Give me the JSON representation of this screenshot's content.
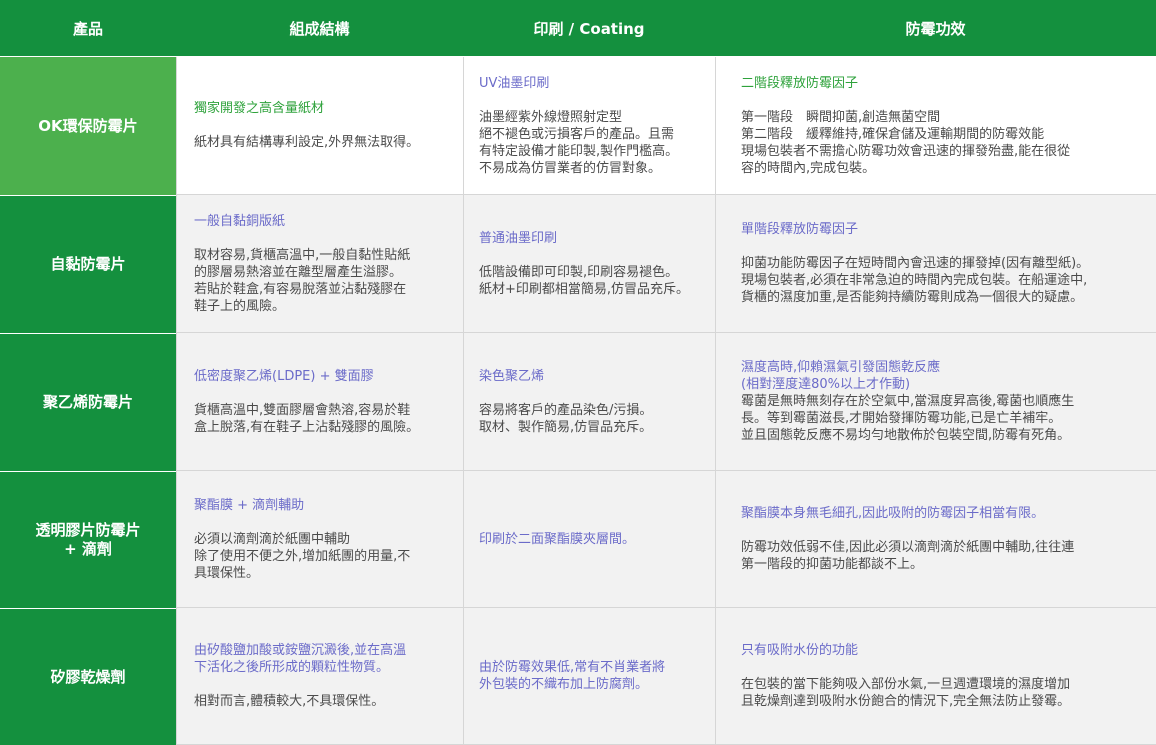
{
  "header": {
    "product": "產品",
    "structure": "組成結構",
    "printing": "印刷 / Coating",
    "effect": "防霉功效"
  },
  "rows": [
    {
      "name_lines": [
        "OK環保防霉片"
      ],
      "structure": {
        "title": "獨家開發之高含量紙材",
        "body": [
          "紙材具有結構專利設定,外界無法取得。"
        ]
      },
      "printing": {
        "title": "UV油墨印刷",
        "body": [
          "油墨經紫外線燈照射定型",
          "絕不褪色或污損客戶的產品。且需",
          "有特定設備才能印製,製作門檻高。",
          "不易成為仿冒業者的仿冒對象。"
        ]
      },
      "effect": {
        "title": "二階段釋放防霉因子",
        "body": [
          "第一階段　瞬間抑菌,創造無菌空間",
          "第二階段　緩釋維持,確保倉儲及運輸期間的防霉效能",
          "現場包裝者不需擔心防霉功效會迅速的揮發殆盡,能在很從",
          "容的時間內,完成包裝。"
        ]
      }
    },
    {
      "name_lines": [
        "自黏防霉片"
      ],
      "structure": {
        "title": "一般自黏銅版紙",
        "body": [
          "取材容易,貨櫃高溫中,一般自黏性貼紙",
          "的膠層易熱溶並在離型層產生溢膠。",
          "若貼於鞋盒,有容易脫落並沾黏殘膠在",
          "鞋子上的風險。"
        ]
      },
      "printing": {
        "title": "普通油墨印刷",
        "body": [
          "低階設備即可印製,印刷容易褪色。",
          "紙材+印刷都相當簡易,仿冒品充斥。"
        ]
      },
      "effect": {
        "title": "單階段釋放防霉因子",
        "body": [
          "抑菌功能防霉因子在短時間內會迅速的揮發掉(因有離型紙)。",
          "現場包裝者,必須在非常急迫的時間內完成包裝。在船運途中,",
          "貨櫃的濕度加重,是否能夠持續防霉則成為一個很大的疑慮。"
        ]
      }
    },
    {
      "name_lines": [
        "聚乙烯防霉片"
      ],
      "structure": {
        "title": "低密度聚乙烯(LDPE) + 雙面膠",
        "body": [
          "貨櫃高溫中,雙面膠層會熱溶,容易於鞋",
          "盒上脫落,有在鞋子上沾黏殘膠的風險。"
        ]
      },
      "printing": {
        "title": "染色聚乙烯",
        "body": [
          "容易將客戶的產品染色/污損。",
          "取材、製作簡易,仿冒品充斥。"
        ]
      },
      "effect": {
        "title": "濕度高時,仰賴濕氣引發固態乾反應",
        "subtitle": "(相對溼度達80%以上才作動)",
        "body": [
          "霉菌是無時無刻存在於空氣中,當濕度昇高後,霉菌也順應生",
          "長。等到霉菌滋長,才開始發揮防霉功能,已是亡羊補牢。",
          "並且固態乾反應不易均勻地散佈於包裝空間,防霉有死角。"
        ]
      }
    },
    {
      "name_lines": [
        "透明膠片防霉片",
        "+ 滴劑"
      ],
      "structure": {
        "title": "聚酯膜 + 滴劑輔助",
        "body": [
          "必須以滴劑滴於紙團中輔助",
          "除了使用不便之外,增加紙團的用量,不",
          "具環保性。"
        ]
      },
      "printing": {
        "title": "印刷於二面聚酯膜夾層間。",
        "body": []
      },
      "effect": {
        "title": "聚酯膜本身無毛細孔,因此吸附的防霉因子相當有限。",
        "body": [
          "防霉功效低弱不佳,因此必須以滴劑滴於紙團中輔助,往往連",
          "第一階段的抑菌功能都談不上。"
        ]
      }
    },
    {
      "name_lines": [
        "矽膠乾燥劑"
      ],
      "structure": {
        "title_lines": [
          "由矽酸鹽加酸或銨鹽沉澱後,並在高溫",
          "下活化之後所形成的顆粒性物質。"
        ],
        "body": [
          "相對而言,體積較大,不具環保性。"
        ]
      },
      "printing": {
        "title_lines": [
          "由於防霉效果低,常有不肖業者將",
          "外包裝的不織布加上防腐劑。"
        ],
        "body": []
      },
      "effect": {
        "title": "只有吸附水份的功能",
        "body": [
          "在包裝的當下能夠吸入部份水氣,一旦週遭環境的濕度增加",
          "且乾燥劑達到吸附水份飽合的情況下,完全無法防止發霉。"
        ]
      }
    }
  ],
  "colors": {
    "header_green": "#14903e",
    "ok_row_green": "#4cb04d",
    "title_green": "#2ea23b",
    "title_purple": "#6b6bc9",
    "grey_cell": "#f2f2f2"
  }
}
